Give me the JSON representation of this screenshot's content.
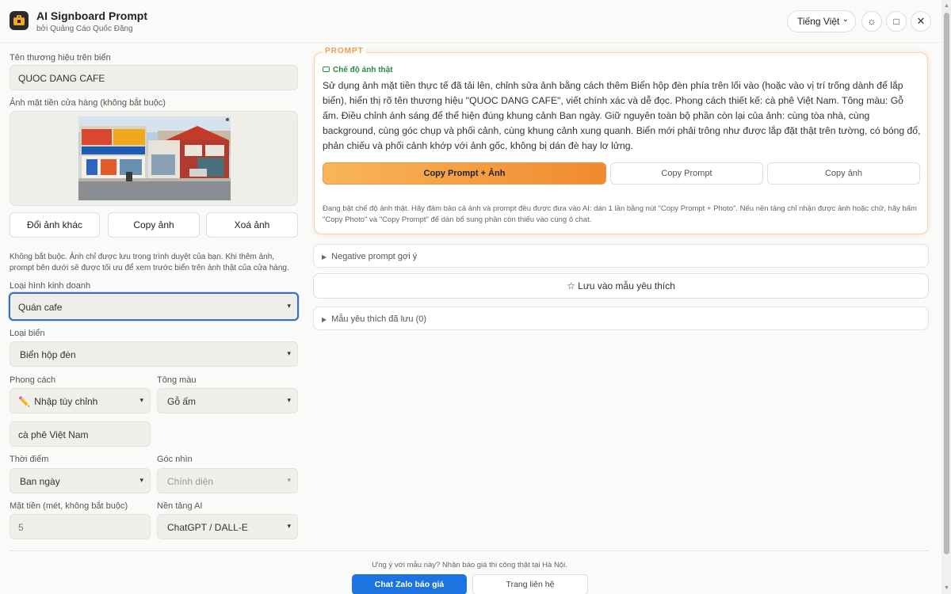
{
  "header": {
    "title": "AI Signboard Prompt",
    "subtitle": "bởi Quảng Cáo Quốc Đăng",
    "language": "Tiếng Việt",
    "theme_icon": "sun-icon",
    "maximize_icon": "square-icon",
    "close_icon": "close-icon"
  },
  "form": {
    "brand_label": "Tên thương hiệu trên biển",
    "brand_value": "QUOC DANG CAFE",
    "photo_label": "Ảnh mặt tiền cửa hàng (không bắt buộc)",
    "change_photo": "Đổi ảnh khác",
    "copy_photo": "Copy ảnh",
    "delete_photo": "Xoá ảnh",
    "note": "Không bắt buộc. Ảnh chỉ được lưu trong trình duyệt của bạn. Khi thêm ảnh, prompt bên dưới sẽ được tối ưu để xem trước biển trên ảnh thật của cửa hàng.",
    "business_label": "Loại hình kinh doanh",
    "business_value": "Quán cafe",
    "sign_type_label": "Loại biển",
    "sign_type_value": "Biển hộp đèn",
    "style_label": "Phong cách",
    "style_value": "Nhập tùy chỉnh",
    "style_custom": "cà phê Việt Nam",
    "color_label": "Tông màu",
    "color_value": "Gỗ ấm",
    "time_label": "Thời điểm",
    "time_value": "Ban ngày",
    "angle_label": "Góc nhìn",
    "angle_value": "Chính diện",
    "width_label": "Mặt tiền (mét, không bắt buộc)",
    "width_value": "5",
    "platform_label": "Nền tảng AI",
    "platform_value": "ChatGPT / DALL-E"
  },
  "prompt": {
    "tag": "PROMPT",
    "mode": "Chế độ ảnh thật",
    "text": "Sử dụng ảnh mặt tiền thực tế đã tải lên, chỉnh sửa ảnh bằng cách thêm Biển hộp đèn phía trên lối vào (hoặc vào vị trí trống dành để lắp biển), hiển thị rõ tên thương hiệu \"QUOC DANG CAFE\", viết chính xác và dễ đọc. Phong cách thiết kế: cà phê Việt Nam. Tông màu: Gỗ ấm. Điều chỉnh ánh sáng để thể hiện đúng khung cảnh Ban ngày. Giữ nguyên toàn bộ phần còn lại của ảnh: cùng tòa nhà, cùng background, cùng góc chụp và phối cảnh, cùng khung cảnh xung quanh. Biển mới phải trông như được lắp đặt thật trên tường, có bóng đổ, phản chiếu và phối cảnh khớp với ảnh gốc, không bị dán đè hay lơ lửng.",
    "copy_both": "Copy Prompt + Ảnh",
    "copy_prompt": "Copy Prompt",
    "copy_image": "Copy ảnh",
    "hint": "Đang bật chế độ ảnh thật. Hãy đảm bảo cả ảnh và prompt đều được đưa vào AI: dán 1 lần bằng nút \"Copy Prompt + Photo\". Nếu nền tảng chỉ nhận được ảnh hoặc chữ, hãy bấm \"Copy Photo\" và \"Copy Prompt\" để dán bổ sung phần còn thiếu vào cùng ô chat."
  },
  "panels": {
    "negative": "Negative prompt gợi ý",
    "save_fav": "☆ Lưu vào mẫu yêu thích",
    "saved": "Mẫu yêu thích đã lưu (0)"
  },
  "footer": {
    "text": "Ưng ý với mẫu này? Nhận báo giá thi công thật tại Hà Nội.",
    "zalo": "Chat Zalo báo giá",
    "contact": "Trang liên hệ"
  },
  "colors": {
    "accent": "#f08a2e",
    "blue": "#1d74e0",
    "green": "#2a8a4a"
  }
}
